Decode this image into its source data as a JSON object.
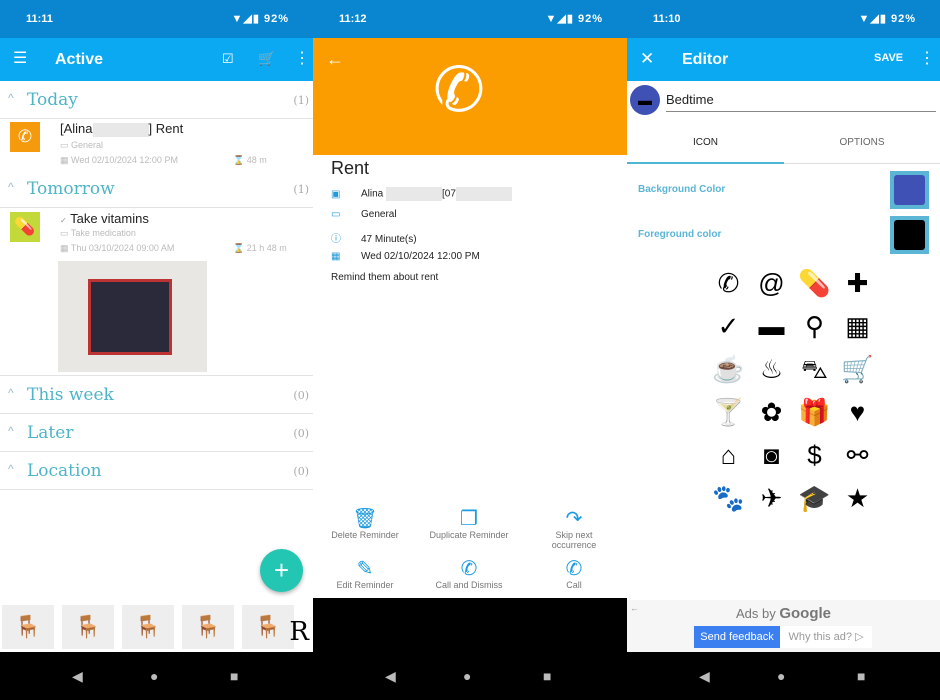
{
  "list_screen": {
    "status": {
      "time": "11:11",
      "battery": "92%"
    },
    "appbar": {
      "title": "Active"
    },
    "sections": [
      {
        "name": "Today",
        "count": "(1)"
      },
      {
        "name": "Tomorrow",
        "count": "(1)"
      },
      {
        "name": "This week",
        "count": "(0)"
      },
      {
        "name": "Later",
        "count": "(0)"
      },
      {
        "name": "Location",
        "count": "(0)"
      }
    ],
    "items": [
      {
        "title_prefix": "[Alina",
        "title_suffix": "] Rent",
        "category": "General",
        "date": "Wed 02/10/2024 12:00 PM",
        "remaining": "48 m",
        "icon": "phone-icon",
        "color": "#f59a0c"
      },
      {
        "title": "Take vitamins",
        "category": "Take medication",
        "date": "Thu 03/10/2024 09:00 AM",
        "remaining": "21 h 48 m",
        "icon": "pill-icon",
        "color": "#c3d93a"
      }
    ],
    "fab": "+",
    "ad_letter": "R"
  },
  "detail_screen": {
    "status": {
      "time": "11:12",
      "battery": "92%"
    },
    "header_color": "#fb9c00",
    "title": "Rent",
    "contact_prefix": "Alina",
    "contact_suffix": "[07",
    "category": "General",
    "duration": "47 Minute(s)",
    "date": "Wed 02/10/2024 12:00 PM",
    "note": "Remind them about rent",
    "actions": [
      "Delete Reminder",
      "Duplicate Reminder",
      "Skip next occurrence",
      "Edit Reminder",
      "Call and Dismiss",
      "Call"
    ]
  },
  "editor_screen": {
    "status": {
      "time": "11:10",
      "battery": "92%"
    },
    "appbar": {
      "title": "Editor",
      "save": "SAVE"
    },
    "name_value": "Bedtime",
    "tabs": [
      "ICON",
      "OPTIONS"
    ],
    "active_tab": "ICON",
    "background_color_label": "Background Color",
    "background_color": "#3f51b5",
    "foreground_color_label": "Foreground color",
    "foreground_color": "#000000",
    "icons": [
      "phone",
      "at",
      "pill",
      "medical-cross",
      "check",
      "bed",
      "bicycle",
      "building",
      "coffee",
      "cake",
      "car",
      "cart",
      "cocktail",
      "flower",
      "gift",
      "heart",
      "home",
      "washing-machine",
      "dollar",
      "motorcycle",
      "paw",
      "airplane",
      "graduation-cap",
      "star"
    ],
    "ads": {
      "label_prefix": "Ads by ",
      "label_brand": "Google",
      "send_feedback": "Send feedback",
      "why": "Why this ad?"
    }
  }
}
